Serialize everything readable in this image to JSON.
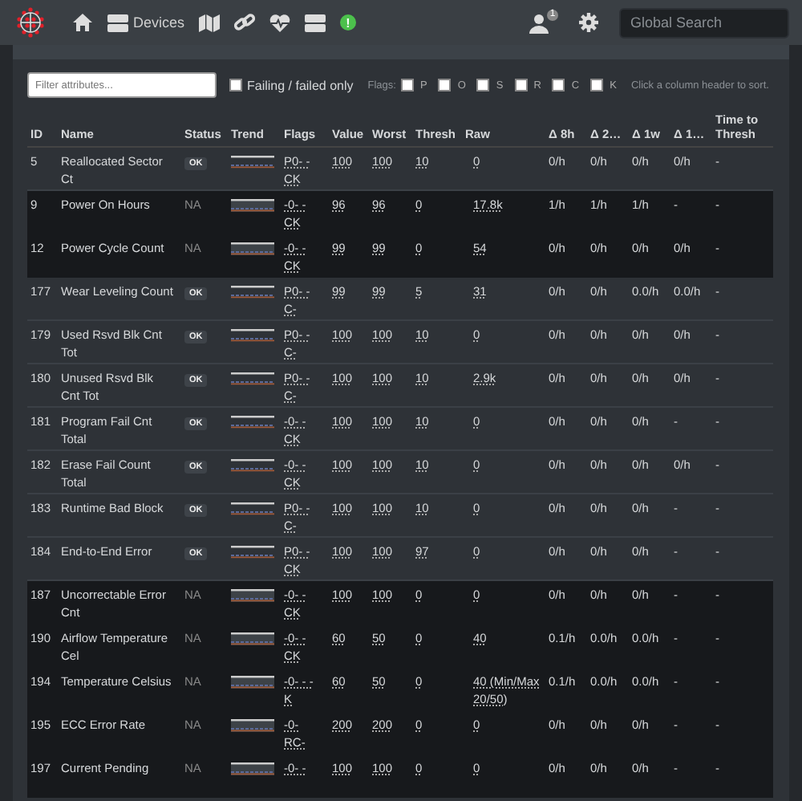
{
  "navbar": {
    "items": [
      {
        "kind": "home"
      },
      {
        "kind": "devices",
        "label": "Devices"
      },
      {
        "kind": "map"
      },
      {
        "kind": "link"
      },
      {
        "kind": "health"
      },
      {
        "kind": "server"
      },
      {
        "kind": "alert",
        "label": "!"
      }
    ],
    "user_badge": "1",
    "search": {
      "placeholder": "Global Search"
    }
  },
  "filters": {
    "placeholder": "Filter attributes...",
    "failing_only": {
      "label": "Failing / failed only",
      "checked": false
    },
    "flags_label": "Flags:",
    "flags": [
      {
        "label": "P",
        "checked": false
      },
      {
        "label": "O",
        "checked": false
      },
      {
        "label": "S",
        "checked": false
      },
      {
        "label": "R",
        "checked": false
      },
      {
        "label": "C",
        "checked": false
      },
      {
        "label": "K",
        "checked": false
      }
    ],
    "hint": "Click a column header to sort."
  },
  "table": {
    "columns": [
      "ID",
      "Name",
      "Status",
      "Trend",
      "Flags",
      "Value",
      "Worst",
      "Thresh",
      "Raw",
      "Δ 8h",
      "Δ 2…",
      "Δ 1w",
      "Δ 1…",
      "Time to Thresh"
    ],
    "rows": [
      {
        "id": "5",
        "name": "Reallocated Sector Ct",
        "status": "OK",
        "kind": "badge",
        "flags": [
          "P0- -",
          "CK"
        ],
        "value": "100",
        "worst": "100",
        "thresh": "10",
        "raw": "0",
        "d8h": "0/h",
        "d2": "0/h",
        "d1w": "0/h",
        "d1": "0/h",
        "ttt": "-"
      },
      {
        "id": "9",
        "name": "Power On Hours",
        "status": "NA",
        "kind": "plain",
        "flags": [
          "-0- -",
          "CK"
        ],
        "value": "96",
        "worst": "96",
        "thresh": "0",
        "raw": "17.8k",
        "d8h": "1/h",
        "d2": "1/h",
        "d1w": "1/h",
        "d1": "-",
        "ttt": "-"
      },
      {
        "id": "12",
        "name": "Power Cycle Count",
        "status": "NA",
        "kind": "plain",
        "flags": [
          "-0- -",
          "CK"
        ],
        "value": "99",
        "worst": "99",
        "thresh": "0",
        "raw": "54",
        "d8h": "0/h",
        "d2": "0/h",
        "d1w": "0/h",
        "d1": "0/h",
        "ttt": "-"
      },
      {
        "id": "177",
        "name": "Wear Leveling Count",
        "status": "OK",
        "kind": "badge",
        "flags": [
          "P0- -",
          "C-"
        ],
        "value": "99",
        "worst": "99",
        "thresh": "5",
        "raw": "31",
        "d8h": "0/h",
        "d2": "0/h",
        "d1w": "0.0/h",
        "d1": "0.0/h",
        "ttt": "-"
      },
      {
        "id": "179",
        "name": "Used Rsvd Blk Cnt Tot",
        "status": "OK",
        "kind": "badge",
        "flags": [
          "P0- -",
          "C-"
        ],
        "value": "100",
        "worst": "100",
        "thresh": "10",
        "raw": "0",
        "d8h": "0/h",
        "d2": "0/h",
        "d1w": "0/h",
        "d1": "0/h",
        "ttt": "-"
      },
      {
        "id": "180",
        "name": "Unused Rsvd Blk Cnt Tot",
        "status": "OK",
        "kind": "badge",
        "flags": [
          "P0- -",
          "C-"
        ],
        "value": "100",
        "worst": "100",
        "thresh": "10",
        "raw": "2.9k",
        "d8h": "0/h",
        "d2": "0/h",
        "d1w": "0/h",
        "d1": "0/h",
        "ttt": "-"
      },
      {
        "id": "181",
        "name": "Program Fail Cnt Total",
        "status": "OK",
        "kind": "badge",
        "flags": [
          "-0- -",
          "CK"
        ],
        "value": "100",
        "worst": "100",
        "thresh": "10",
        "raw": "0",
        "d8h": "0/h",
        "d2": "0/h",
        "d1w": "0/h",
        "d1": "-",
        "ttt": "-"
      },
      {
        "id": "182",
        "name": "Erase Fail Count Total",
        "status": "OK",
        "kind": "badge",
        "flags": [
          "-0- -",
          "CK"
        ],
        "value": "100",
        "worst": "100",
        "thresh": "10",
        "raw": "0",
        "d8h": "0/h",
        "d2": "0/h",
        "d1w": "0/h",
        "d1": "0/h",
        "ttt": "-"
      },
      {
        "id": "183",
        "name": "Runtime Bad Block",
        "status": "OK",
        "kind": "badge",
        "flags": [
          "P0- -",
          "C-"
        ],
        "value": "100",
        "worst": "100",
        "thresh": "10",
        "raw": "0",
        "d8h": "0/h",
        "d2": "0/h",
        "d1w": "0/h",
        "d1": "-",
        "ttt": "-"
      },
      {
        "id": "184",
        "name": "End-to-End Error",
        "status": "OK",
        "kind": "badge",
        "flags": [
          "P0- -",
          "CK"
        ],
        "value": "100",
        "worst": "100",
        "thresh": "97",
        "raw": "0",
        "d8h": "0/h",
        "d2": "0/h",
        "d1w": "0/h",
        "d1": "-",
        "ttt": "-"
      },
      {
        "id": "187",
        "name": "Uncorrectable Error Cnt",
        "status": "NA",
        "kind": "plain",
        "flags": [
          "-0- -",
          "CK"
        ],
        "value": "100",
        "worst": "100",
        "thresh": "0",
        "raw": "0",
        "d8h": "0/h",
        "d2": "0/h",
        "d1w": "0/h",
        "d1": "-",
        "ttt": "-"
      },
      {
        "id": "190",
        "name": "Airflow Temperature Cel",
        "status": "NA",
        "kind": "plain",
        "flags": [
          "-0- -",
          "CK"
        ],
        "value": "60",
        "worst": "50",
        "thresh": "0",
        "raw": "40",
        "d8h": "0.1/h",
        "d2": "0.0/h",
        "d1w": "0.0/h",
        "d1": "-",
        "ttt": "-"
      },
      {
        "id": "194",
        "name": "Temperature Celsius",
        "status": "NA",
        "kind": "plain",
        "flags": [
          "-0- - -",
          "K"
        ],
        "value": "60",
        "worst": "50",
        "thresh": "0",
        "raw": "40 (Min/Max 20/50)",
        "d8h": "0.1/h",
        "d2": "0.0/h",
        "d1w": "0.0/h",
        "d1": "-",
        "ttt": "-"
      },
      {
        "id": "195",
        "name": "ECC Error Rate",
        "status": "NA",
        "kind": "plain",
        "flags": [
          "-0-",
          "RC-"
        ],
        "value": "200",
        "worst": "200",
        "thresh": "0",
        "raw": "0",
        "d8h": "0/h",
        "d2": "0/h",
        "d1w": "0/h",
        "d1": "-",
        "ttt": "-"
      },
      {
        "id": "197",
        "name": "Current Pending",
        "status": "NA",
        "kind": "plain",
        "flags": [
          "-0- -"
        ],
        "value": "100",
        "worst": "100",
        "thresh": "0",
        "raw": "0",
        "d8h": "0/h",
        "d2": "0/h",
        "d1w": "0/h",
        "d1": "-",
        "ttt": "-"
      }
    ]
  }
}
